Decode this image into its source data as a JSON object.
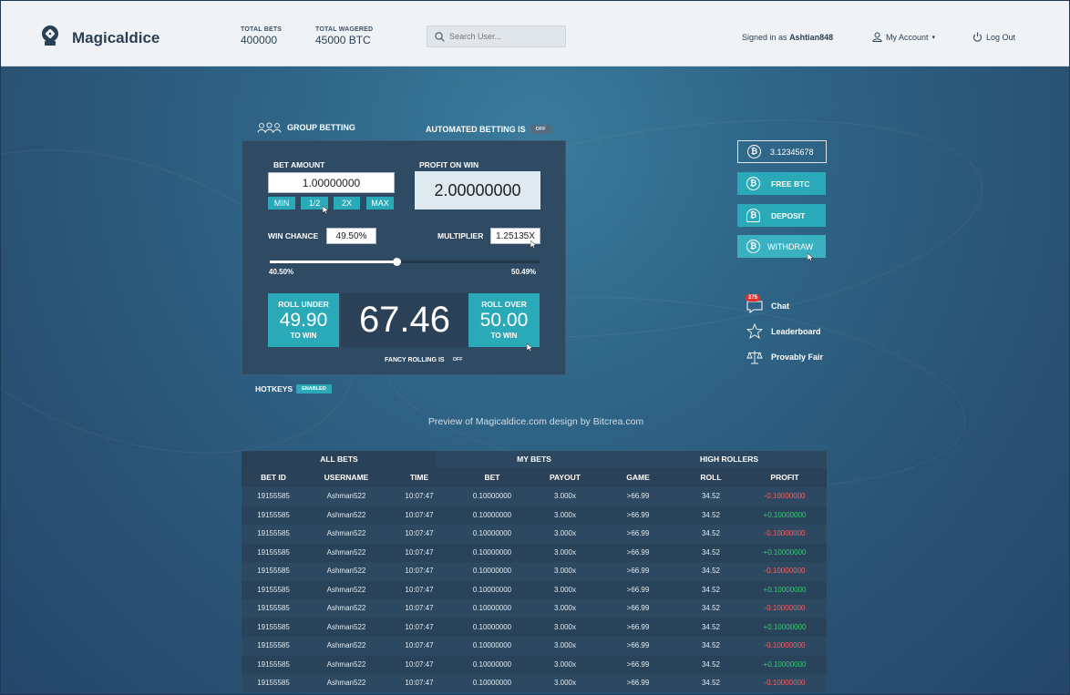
{
  "header": {
    "brand": "Magicaldice",
    "stats": [
      {
        "label": "TOTAL BETS",
        "value": "400000"
      },
      {
        "label": "TOTAL WAGERED",
        "value": "45000 BTC"
      }
    ],
    "search_placeholder": "Search User...",
    "signed_in_prefix": "Signed in as",
    "username": "Ashtian848",
    "account_label": "My Account",
    "logout_label": "Log Out"
  },
  "controls": {
    "group_betting_label": "GROUP BETTING",
    "automated_betting_label": "AUTOMATED BETTING IS",
    "automated_betting_state": "OFF"
  },
  "panel": {
    "bet_amount_label": "BET AMOUNT",
    "bet_amount": "1.00000000",
    "quick_buttons": [
      "MIN",
      "1/2",
      "2X",
      "MAX"
    ],
    "profit_label": "PROFIT ON WIN",
    "profit": "2.00000000",
    "win_chance_label": "WIN CHANCE",
    "win_chance": "49.50%",
    "multiplier_label": "MULTIPLIER",
    "multiplier": "1.25135X",
    "slider_min": "40.50%",
    "slider_max": "50.49%",
    "slider_level": 0.47,
    "roll_under": {
      "title": "ROLL UNDER",
      "value": "49.90",
      "sub": "TO WIN"
    },
    "result": "67.46",
    "roll_over": {
      "title": "ROLL OVER",
      "value": "50.00",
      "sub": "TO WIN"
    },
    "fancy_rolling_label": "FANCY ROLLING IS",
    "fancy_rolling_state": "OFF"
  },
  "hotkeys": {
    "label": "HOTKEYS",
    "state": "ENABLED"
  },
  "sidebar": {
    "balance": "3.12345678",
    "buttons": [
      "FREE BTC",
      "DEPOSIT",
      "WITHDRAW"
    ],
    "chat_badge": "275",
    "links": [
      "Chat",
      "Leaderboard",
      "Provably Fair"
    ]
  },
  "footer_note": "Preview of Magicaldice.com design by Bitcrea.com",
  "bets_table": {
    "tabs": [
      "ALL BETS",
      "MY BETS",
      "HIGH ROLLERS"
    ],
    "columns": [
      "BET ID",
      "USERNAME",
      "TIME",
      "BET",
      "PAYOUT",
      "GAME",
      "ROLL",
      "PROFIT"
    ],
    "rows": [
      [
        "19155585",
        "Ashman522",
        "10:07:47",
        "0.10000000",
        "3.000x",
        ">66.99",
        "34.52",
        "-0.10000000"
      ],
      [
        "19155585",
        "Ashman522",
        "10:07:47",
        "0.10000000",
        "3.000x",
        ">66.99",
        "34.52",
        "+0.10000000"
      ],
      [
        "19155585",
        "Ashman522",
        "10:07:47",
        "0.10000000",
        "3.000x",
        ">66.99",
        "34.52",
        "-0.10000000"
      ],
      [
        "19155585",
        "Ashman522",
        "10:07:47",
        "0.10000000",
        "3.000x",
        ">66.99",
        "34.52",
        "+0.10000000"
      ],
      [
        "19155585",
        "Ashman522",
        "10:07:47",
        "0.10000000",
        "3.000x",
        ">66.99",
        "34.52",
        "-0.10000000"
      ],
      [
        "19155585",
        "Ashman522",
        "10:07:47",
        "0.10000000",
        "3.000x",
        ">66.99",
        "34.52",
        "+0.10000000"
      ],
      [
        "19155585",
        "Ashman522",
        "10:07:47",
        "0.10000000",
        "3.000x",
        ">66.99",
        "34.52",
        "-0.10000000"
      ],
      [
        "19155585",
        "Ashman522",
        "10:07:47",
        "0.10000000",
        "3.000x",
        ">66.99",
        "34.52",
        "+0.10000000"
      ],
      [
        "19155585",
        "Ashman522",
        "10:07:47",
        "0.10000000",
        "3.000x",
        ">66.99",
        "34.52",
        "-0.10000000"
      ],
      [
        "19155585",
        "Ashman522",
        "10:07:47",
        "0.10000000",
        "3.000x",
        ">66.99",
        "34.52",
        "+0.10000000"
      ],
      [
        "19155585",
        "Ashman522",
        "10:07:47",
        "0.10000000",
        "3.000x",
        ">66.99",
        "34.52",
        "-0.10000000"
      ]
    ]
  }
}
